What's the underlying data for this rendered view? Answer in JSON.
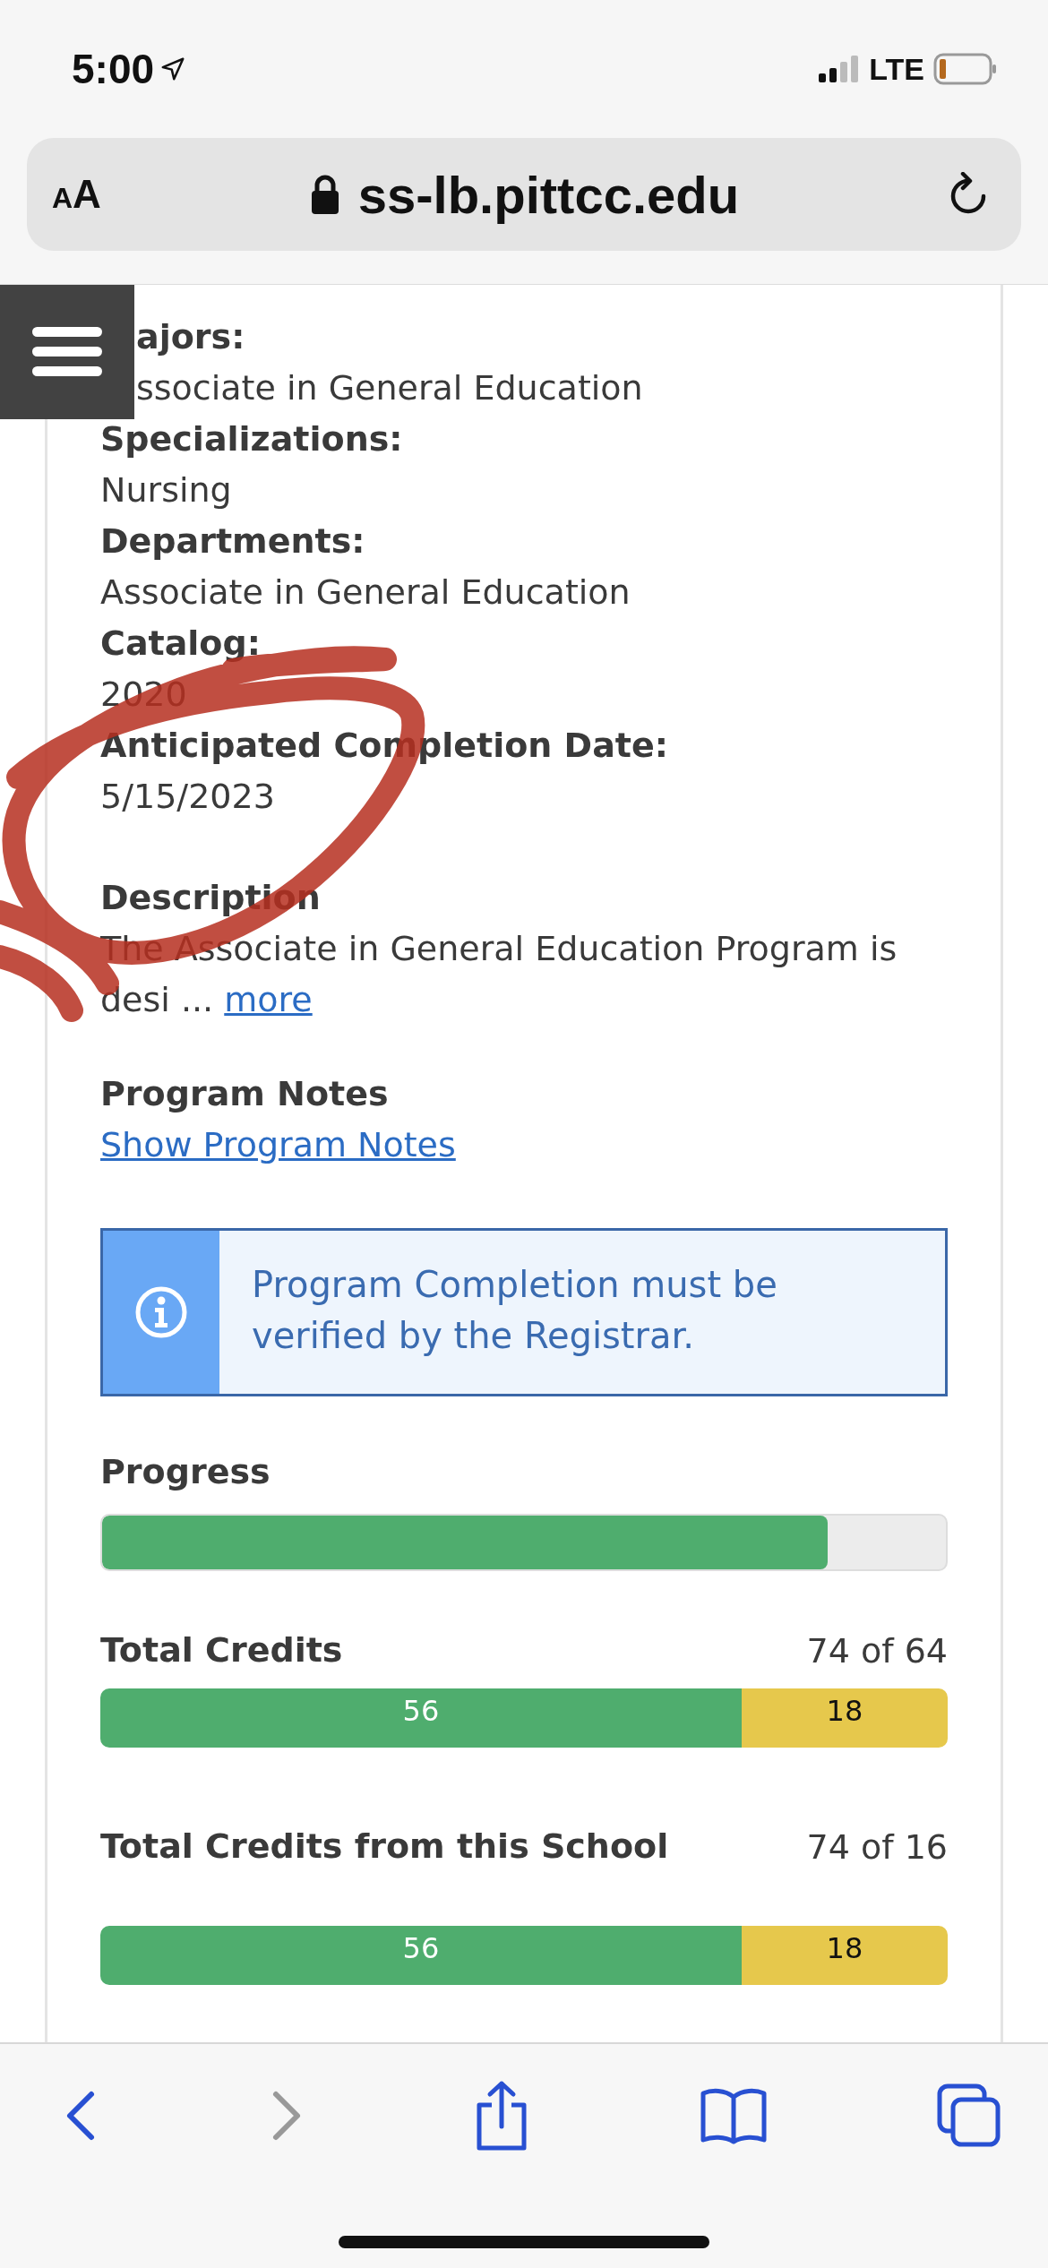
{
  "status_bar": {
    "time": "5:00",
    "network": "LTE"
  },
  "address_bar": {
    "text_size": [
      "A",
      "A"
    ],
    "url": "ss-lb.pittcc.edu"
  },
  "program_details": [
    {
      "label": "ajors:",
      "value": "ssociate in General Education"
    },
    {
      "label": "Specializations:",
      "value": "Nursing"
    },
    {
      "label": "Departments:",
      "value": "Associate in General Education"
    },
    {
      "label": "Catalog:",
      "value": "2020"
    },
    {
      "label": "Anticipated Completion Date:",
      "value": "5/15/2023"
    }
  ],
  "description": {
    "label": "Description",
    "text": "The Associate in General Education Program is desi ...",
    "more_link": "more"
  },
  "program_notes": {
    "label": "Program Notes",
    "link": "Show Program Notes"
  },
  "notice": "Program Completion must be verified by the Registrar.",
  "progress": {
    "label": "Progress",
    "level": 0.86
  },
  "credit_bars": [
    {
      "label": "Total Credits",
      "reading": "74 of 64",
      "segments": [
        {
          "value": "56",
          "color": "#4fad6e"
        },
        {
          "value": "18",
          "color": "#e6c84c"
        }
      ]
    },
    {
      "label": "Total Credits from this School",
      "reading": "74 of 16",
      "segments": [
        {
          "value": "56",
          "color": "#4fad6e"
        },
        {
          "value": "18",
          "color": "#e6c84c"
        }
      ]
    }
  ],
  "toolbar": [
    {
      "kind": "back",
      "disabled": false
    },
    {
      "kind": "forward",
      "disabled": true
    },
    {
      "kind": "share",
      "disabled": false
    },
    {
      "kind": "bookmarks",
      "disabled": false
    },
    {
      "kind": "tabs",
      "disabled": false
    }
  ]
}
